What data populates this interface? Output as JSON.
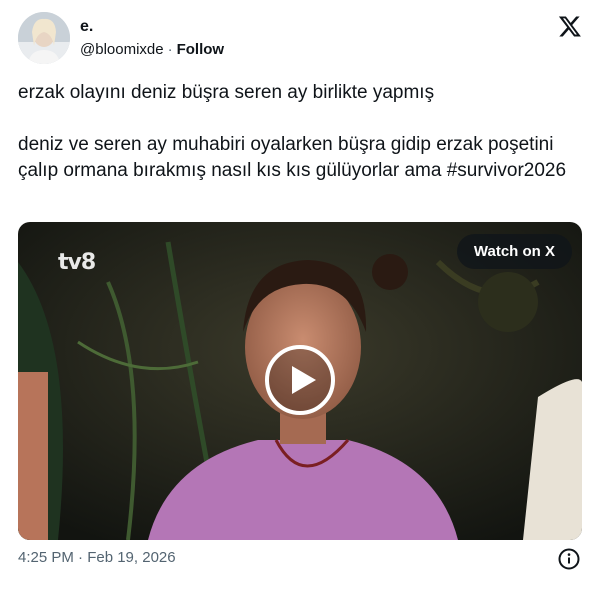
{
  "author": {
    "name": "e.",
    "handle": "@bloomixde",
    "separator": "·",
    "follow_label": "Follow"
  },
  "icons": {
    "platform_logo": "x-logo-icon",
    "play": "play-icon",
    "info": "info-icon"
  },
  "tweet": {
    "text": "erzak olayını deniz büşra seren ay birlikte yapmış\n\ndeniz ve seren ay muhabiri oyalarken büşra gidip erzak poşetini çalıp ormana bırakmış nasıl kıs kıs gülüyorlar ama #survivor2026"
  },
  "media": {
    "watch_label": "Watch on X",
    "channel_logo": "tv8"
  },
  "footer": {
    "timestamp": "4:25 PM · Feb 19, 2026"
  }
}
